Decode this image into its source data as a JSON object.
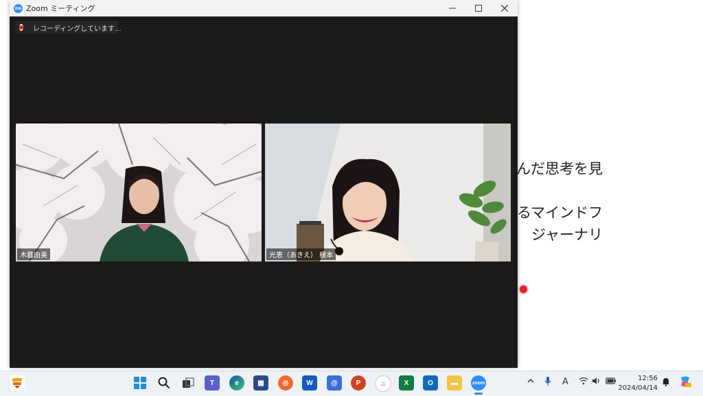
{
  "background_doc": {
    "lines": [
      "んだ思考を見",
      "るマインドフ",
      "ジャーナリ"
    ]
  },
  "window": {
    "title": "Zoom ミーティング",
    "logo_text": "zm",
    "controls": [
      "minimize-icon",
      "maximize-icon",
      "close-icon"
    ]
  },
  "recording": {
    "label": "レコーディングしています..."
  },
  "participants": [
    {
      "name": "木暮由美"
    },
    {
      "name": "光恵（あきえ） 榎本"
    }
  ],
  "taskbar": {
    "apps": [
      "widgets-icon",
      "start-icon",
      "search-icon",
      "task-view-icon",
      "teams-icon",
      "edge-icon",
      "store-icon",
      "app-icon",
      "word-icon",
      "app-icon-2",
      "powerpoint-icon",
      "itunes-icon",
      "excel-icon",
      "outlook-icon",
      "file-explorer-icon",
      "zoom-icon"
    ],
    "tray": [
      "chevron-up-icon",
      "microphone-icon",
      "ime-icon",
      "wifi-icon",
      "speaker-icon",
      "battery-icon",
      "notification-icon",
      "copilot-icon"
    ],
    "ime_label": "A",
    "time": "12:56",
    "date": "2024/04/14"
  },
  "colors": {
    "zoom_blue": "#2d8cff",
    "window_bg": "#1a1a1a",
    "recording_red": "#e0202a"
  }
}
